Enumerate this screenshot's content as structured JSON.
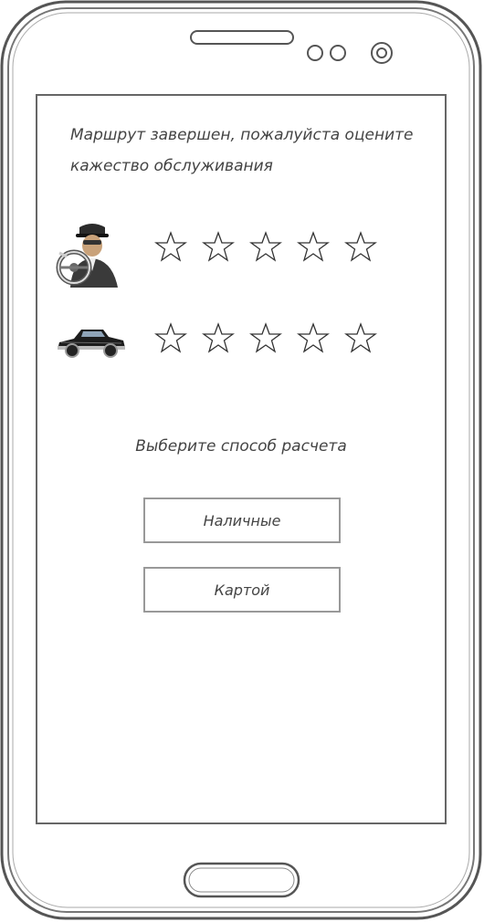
{
  "screen": {
    "title": "Маршрут завершен, пожалуйста оцените кажество обслуживания",
    "ratings": [
      {
        "subject_icon": "driver-icon",
        "stars_total": 5,
        "stars_selected": 0
      },
      {
        "subject_icon": "car-icon",
        "stars_total": 5,
        "stars_selected": 0
      }
    ],
    "payment": {
      "label": "Выберите способ расчета",
      "cash_label": "Наличные",
      "card_label": "Картой"
    }
  }
}
